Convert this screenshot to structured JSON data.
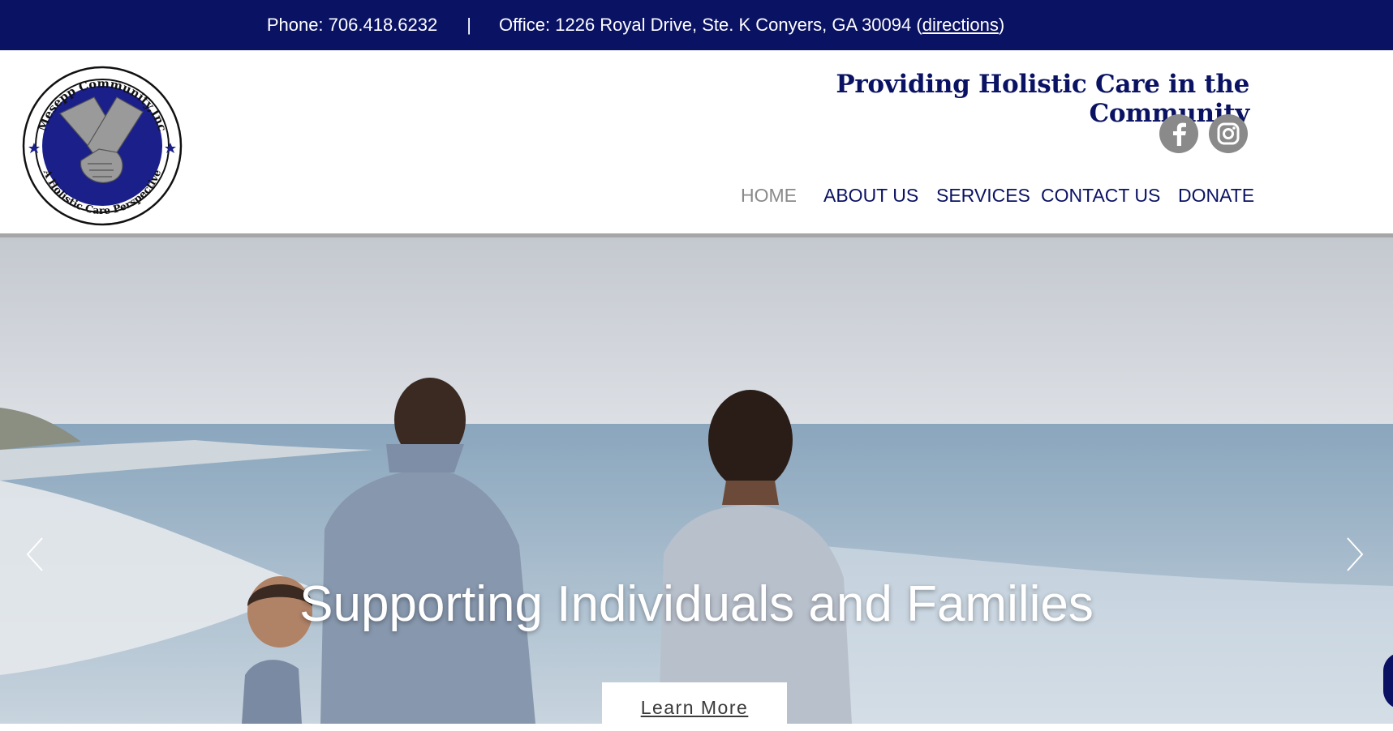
{
  "topbar": {
    "phone": "Phone: 706.418.6232",
    "separator": "|",
    "office": "Office: 1226 Royal Drive, Ste. K Conyers, GA 30094 (",
    "directions_link": "directions",
    "close_paren": ")"
  },
  "brand": {
    "logo_text_top": "Mesepp Community,Inc",
    "logo_text_bottom": "A Holistic Care Perspective",
    "tagline": "Providing Holistic Care in the Community"
  },
  "social": [
    {
      "name": "facebook-icon"
    },
    {
      "name": "instagram-icon"
    }
  ],
  "nav": {
    "items": [
      {
        "label": "HOME",
        "active": true
      },
      {
        "label": "ABOUT US",
        "active": false
      },
      {
        "label": "SERVICES",
        "active": false
      },
      {
        "label": "CONTACT US",
        "active": false
      },
      {
        "label": "DONATE",
        "active": false
      }
    ]
  },
  "hero": {
    "headline": "Supporting Individuals and Families",
    "cta_label": "Learn More"
  },
  "colors": {
    "navy": "#0a1263",
    "nav_active": "#8a8a8a",
    "social_bg": "#8a8a8a"
  }
}
